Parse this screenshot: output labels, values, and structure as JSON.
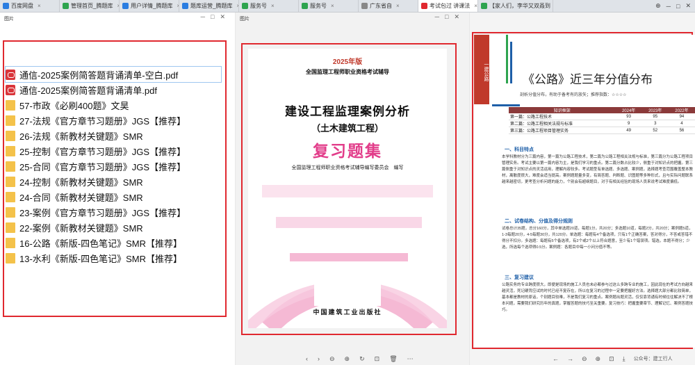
{
  "tabs": [
    {
      "label": "百度网盘",
      "color": "#2a7de1"
    },
    {
      "label": "管理首页_腾题库",
      "color": "#2ea44f"
    },
    {
      "label": "用户详情_腾题库",
      "color": "#2a7de1"
    },
    {
      "label": "题库运营_腾题库",
      "color": "#2a7de1"
    },
    {
      "label": "服务号",
      "color": "#2ea44f"
    },
    {
      "label": "服务号",
      "color": "#2ea44f"
    },
    {
      "label": "广东省自",
      "color": "#888888"
    },
    {
      "label": "考试包过 讲课法",
      "color": "#e0282f"
    },
    {
      "label": "【家人们，李华又双叒到",
      "color": "#2ea44f"
    }
  ],
  "explorer": {
    "title": "图片",
    "files": [
      {
        "name": "通信-2025案例简答题背诵清单-空白.pdf",
        "type": "pdf",
        "selected": true
      },
      {
        "name": "通信-2025案例简答题背诵清单.pdf",
        "type": "pdf"
      },
      {
        "name": "57-市政《必刷400题》文昊",
        "type": "folder"
      },
      {
        "name": "27-法规《官方章节习题册》JGS【推荐】",
        "type": "folder"
      },
      {
        "name": "26-法规《新教材关键题》SMR",
        "type": "folder"
      },
      {
        "name": "25-控制《官方章节习题册》JGS【推荐】",
        "type": "folder"
      },
      {
        "name": "25-合同《官方章节习题册》JGS【推荐】",
        "type": "folder"
      },
      {
        "name": "24-控制《新教材关键题》SMR",
        "type": "folder"
      },
      {
        "name": "24-合同《新教材关键题》SMR",
        "type": "folder"
      },
      {
        "name": "23-案例《官方章节习题册》JGS【推荐】",
        "type": "folder"
      },
      {
        "name": "22-案例《新教材关键题》SMR",
        "type": "folder"
      },
      {
        "name": "16-公路《新版-四色笔记》SMR【推荐】",
        "type": "folder"
      },
      {
        "name": "13-水利《新版-四色笔记》SMR【推荐】",
        "type": "folder"
      }
    ]
  },
  "viewer": {
    "title": "图片",
    "cover": {
      "year": "2025年版",
      "series": "全国监理工程师职业资格考试辅导",
      "title": "建设工程监理案例分析",
      "subtitle": "（土木建筑工程）",
      "review": "复习题集",
      "editor": "全国监理工程师职业资格考试辅导编写委员会　编写",
      "press": "中国建筑工业出版社"
    }
  },
  "doc": {
    "sidebar": "一建公路",
    "title": "《公路》近三年分值分布",
    "subtitle": "剖析分值分布，有助于备考有的放矢；推荐指数：☆☆☆☆",
    "table": {
      "headers": [
        "知识框架",
        "2024年",
        "2023年",
        "2022年"
      ],
      "rows": [
        [
          "第一篇：公路工程技术",
          "93",
          "95",
          "94"
        ],
        [
          "第二篇：公路工程相关法规与标准",
          "9",
          "3",
          "4"
        ],
        [
          "第三篇：公路工程项目管理实务",
          "49",
          "52",
          "56"
        ]
      ]
    },
    "sections": [
      {
        "head": "一、科目特点",
        "text": "本学科教材分为三篇内容，第一篇为公路工程技术，第二篇为公路工程相关法规与标准，第三篇分为公路工程项目管理实务。考试主要以第一篇内容为主，是我们学习的重点。第二篇分数占比较少，侧重于对知识点的把握。第三篇侧重于对知识点的灵活运用，理解内容较多。考试题型有单选题、多选题、案例题，选择题考查范围覆盖整本教材，离散度很大，难度会适当提高。案例题题量多变，有简答题、判断题、识图题等多种形式，且与实际问题联系越来越密切，更考查分析问题的能力，个别会有超纲题目，对于有相关经验的现场人员来说考试难度偏低。"
      },
      {
        "head": "二、试卷结构、分值及得分规则",
        "text": "试卷总计35题，总分160分，其中单选题20道，每题1分，共20分；多选题10道，每题2分，共20分；案例题5道，1-3每题20分，4-5每题30分，共120分。单选题：每题有4个备选项，只有1个正确答案，答对得分，不答或答错不得分不扣分。多选题：每题有5个备选项，有2个或2个以上符合题意，至少有1个错误项。错选，本题不得分；少选，所选每个选项得0.5分。案例题：各题目中每一小问分值不等。"
      },
      {
        "head": "三、复习建议",
        "text": "公路实务的专业跨度很大，即便是现场的施工人员也未必都参与过这么多跨专业的施工，因此现在的考试方向越来越灵活，死记硬背应试的时代已经不复存在，所以在复习的过程中一定要把握好方法。选择题大部分都比较简单，基本都是教材的原话，个别题目较难，不是我们复习的重点。案例题出题灵活，仅仅靠背诵有时候往往解决不了根本问题，需要我们研究历年的真题，掌握答题的技巧至关重要。复习技巧：把握重要章节、理解记忆、案例答题技巧。"
      }
    ],
    "footer": "公众号：建工行人"
  },
  "colors": {
    "red_box": "#e0282f",
    "review_pink": "#e23d8a",
    "table_head": "#8b3a3a"
  }
}
